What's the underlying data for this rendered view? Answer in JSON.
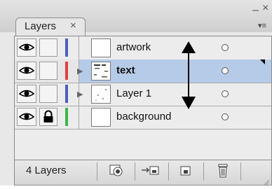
{
  "panel": {
    "tab_label": "Layers",
    "tab_close": "×",
    "minimize": "–",
    "close": "×",
    "menu_icon": "▾≡"
  },
  "layers": [
    {
      "name": "artwork",
      "color": "#4a5fc0",
      "expand": "",
      "locked": false,
      "selected": false,
      "thumb": "blank"
    },
    {
      "name": "text",
      "color": "#e04040",
      "expand": "▶",
      "locked": false,
      "selected": true,
      "thumb": "text"
    },
    {
      "name": "Layer 1",
      "color": "#4a5fc0",
      "expand": "▶",
      "locked": false,
      "selected": false,
      "thumb": "dots"
    },
    {
      "name": "background",
      "color": "#3eb548",
      "expand": "",
      "locked": true,
      "selected": false,
      "thumb": "blank"
    }
  ],
  "footer": {
    "count_label": "4 Layers"
  },
  "colors": {
    "selection": "#b6cbe7"
  }
}
